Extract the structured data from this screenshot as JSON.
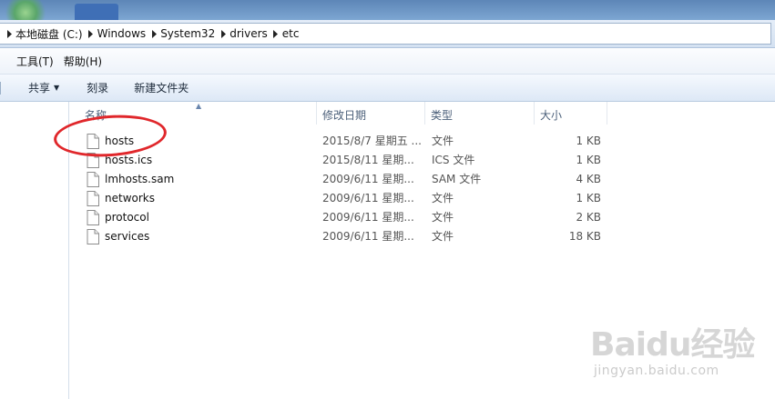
{
  "address": {
    "breadcrumbs": [
      "本地磁盘 (C:)",
      "Windows",
      "System32",
      "drivers",
      "etc"
    ]
  },
  "menu": {
    "items": [
      "工具(T)",
      "帮助(H)"
    ]
  },
  "toolbar": {
    "share_label": "共享",
    "burn_label": "刻录",
    "new_folder_label": "新建文件夹"
  },
  "columns": {
    "name": "名称",
    "date": "修改日期",
    "type": "类型",
    "size": "大小"
  },
  "files": [
    {
      "name": "hosts",
      "date": "2015/8/7 星期五 ...",
      "type": "文件",
      "size": "1 KB"
    },
    {
      "name": "hosts.ics",
      "date": "2015/8/11 星期...",
      "type": "ICS 文件",
      "size": "1 KB"
    },
    {
      "name": "lmhosts.sam",
      "date": "2009/6/11 星期...",
      "type": "SAM 文件",
      "size": "4 KB"
    },
    {
      "name": "networks",
      "date": "2009/6/11 星期...",
      "type": "文件",
      "size": "1 KB"
    },
    {
      "name": "protocol",
      "date": "2009/6/11 星期...",
      "type": "文件",
      "size": "2 KB"
    },
    {
      "name": "services",
      "date": "2009/6/11 星期...",
      "type": "文件",
      "size": "18 KB"
    }
  ],
  "watermark": {
    "brand": "Baidu经验",
    "url": "jingyan.baidu.com"
  },
  "colors": {
    "annotation": "#e0272b",
    "header_text": "#4c607a",
    "title_band": "#6b94c4"
  }
}
